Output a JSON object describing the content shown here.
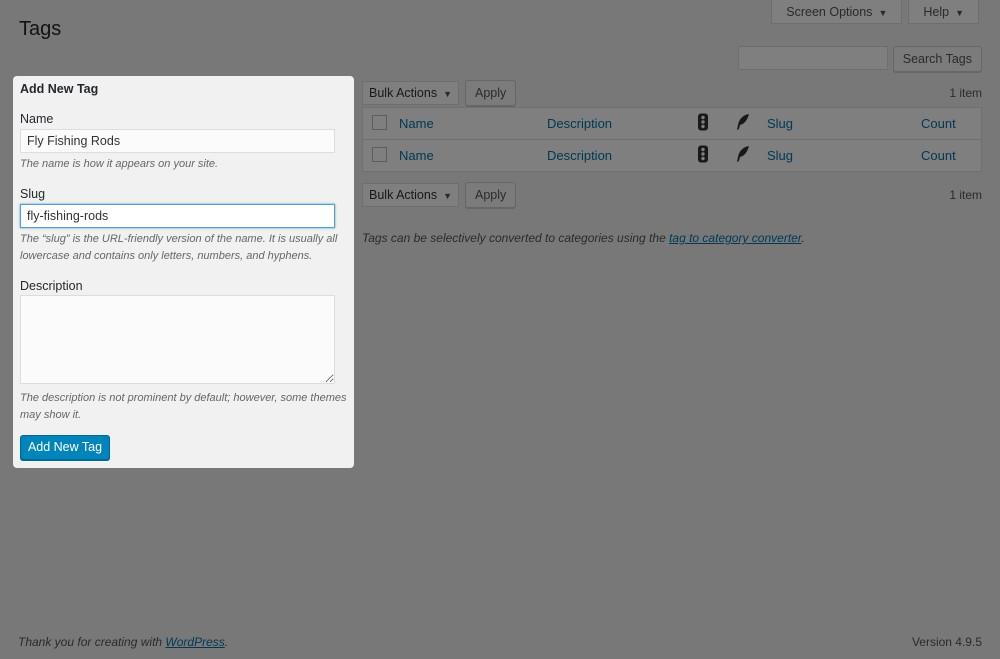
{
  "header": {
    "title": "Tags",
    "screen_options": "Screen Options",
    "help": "Help",
    "search_value": "",
    "search_button": "Search Tags"
  },
  "form": {
    "title": "Add New Tag",
    "name_label": "Name",
    "name_value": "Fly Fishing Rods",
    "name_hint": "The name is how it appears on your site.",
    "slug_label": "Slug",
    "slug_value": "fly-fishing-rods",
    "slug_hint": "The “slug” is the URL-friendly version of the name. It is usually all lowercase and contains only letters, numbers, and hyphens.",
    "description_label": "Description",
    "description_value": "",
    "description_hint": "The description is not prominent by default; however, some themes may show it.",
    "submit": "Add New Tag"
  },
  "table": {
    "bulk_actions": "Bulk Actions",
    "apply": "Apply",
    "item_count": "1 item",
    "columns": {
      "name": "Name",
      "description": "Description",
      "slug": "Slug",
      "count": "Count"
    },
    "icons": [
      "traffic-light-icon",
      "feather-icon"
    ]
  },
  "notes": {
    "converter_prefix": "Tags can be selectively converted to categories using the ",
    "converter_link": "tag to category converter",
    "converter_suffix": "."
  },
  "footer": {
    "thanks_prefix": "Thank you for creating with ",
    "thanks_link": "WordPress",
    "thanks_suffix": ".",
    "version": "Version 4.9.5"
  },
  "colors": {
    "overlay": "#000000",
    "primary": "#0085ba",
    "link": "#0073aa"
  }
}
